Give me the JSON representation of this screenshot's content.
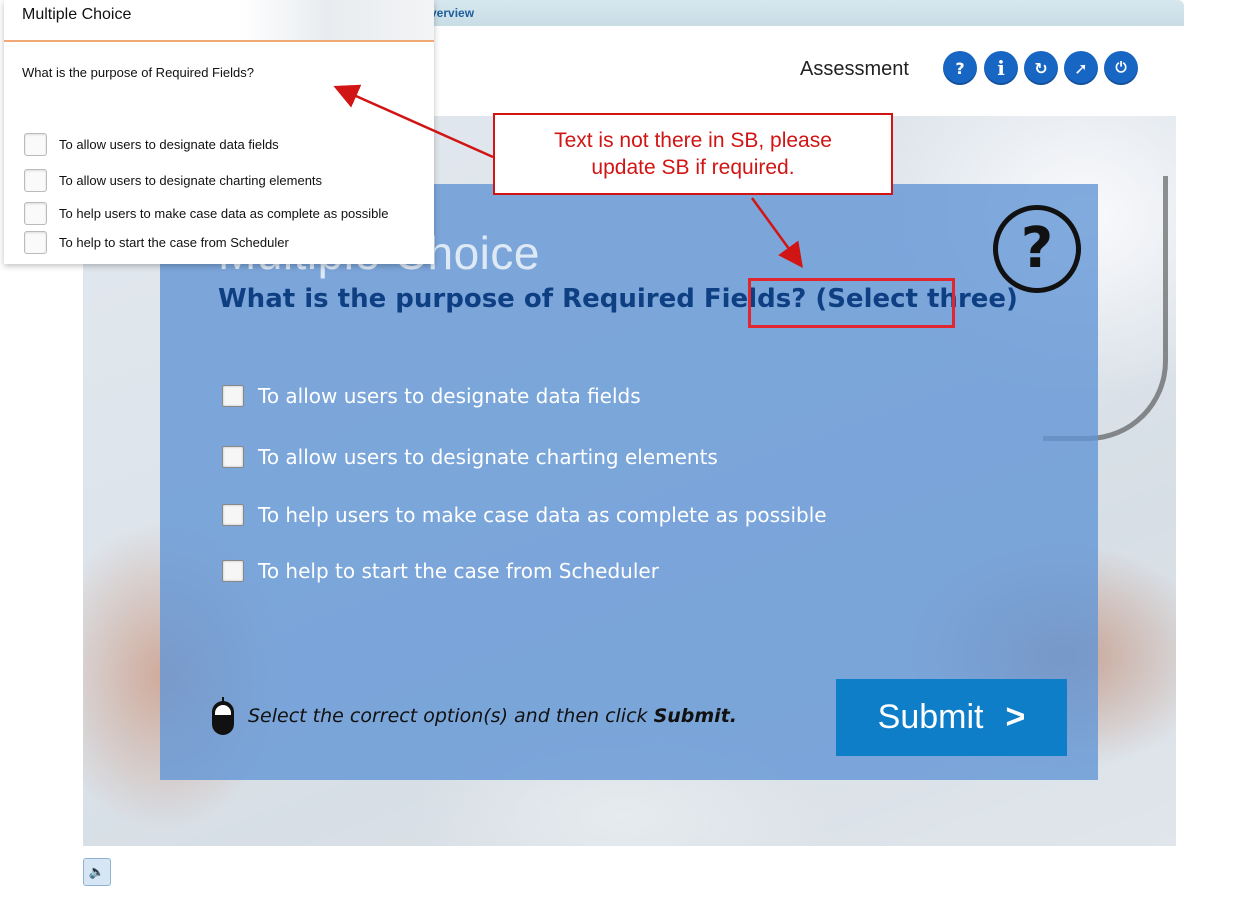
{
  "breadcrumb": {
    "tail": "verview"
  },
  "header": {
    "title": "Assessment",
    "buttons": [
      {
        "name": "help-button",
        "glyph": "?"
      },
      {
        "name": "info-button",
        "glyph": "i"
      },
      {
        "name": "reload-button",
        "glyph": "↻"
      },
      {
        "name": "compass-button",
        "glyph": "➚"
      },
      {
        "name": "power-button",
        "glyph": "⏻"
      }
    ]
  },
  "quiz": {
    "ghost_title": "Multiple Choice",
    "question": "What is the purpose of Required Fields? (Select three)",
    "options": [
      "To allow users to designate data fields",
      "To allow users to designate charting elements",
      "To help users to make case data as complete as possible",
      "To help to start the case from Scheduler"
    ],
    "instruction_prefix": "Select the correct option(s) and then click ",
    "instruction_bold": "Submit.",
    "submit_label": "Submit",
    "submit_chevron": ">",
    "help_glyph": "?"
  },
  "storyboard": {
    "title": "Multiple Choice",
    "question": "What is the purpose of Required Fields?",
    "options": [
      "To allow users to designate data fields",
      "To allow users to designate charting elements",
      "To help users to make case data as complete as possible",
      "To help to start the case from Scheduler"
    ]
  },
  "annotation": {
    "note": "Text is not there in SB, please update SB if required.",
    "color": "#d11414"
  },
  "footer": {
    "audio_icon": "🔈"
  },
  "colors": {
    "panel_overlay": "#6396d6",
    "question_text": "#0e3f82",
    "submit_bg": "#0f7ec8",
    "header_button": "#1866c4"
  }
}
